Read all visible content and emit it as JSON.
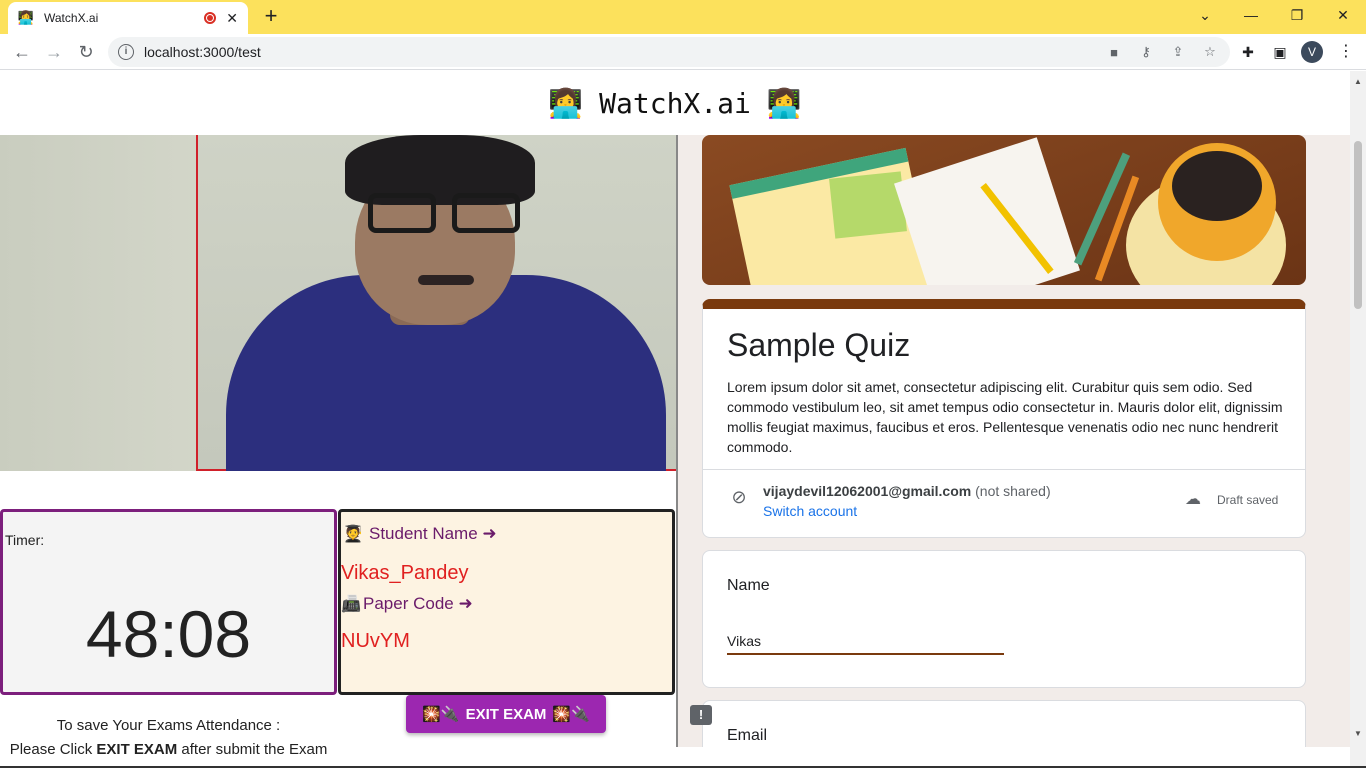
{
  "browser": {
    "tab_title": "WatchX.ai",
    "tab_favicon": "👩‍💻",
    "new_tab_label": "+",
    "url": "localhost:3000/test",
    "avatar_letter": "V",
    "win_controls": {
      "dropdown": "⌄",
      "minimize": "—",
      "restore": "❐",
      "close": "✕"
    }
  },
  "app": {
    "title": "WatchX.ai",
    "emoji": "👩‍💻"
  },
  "timer": {
    "label": "Timer:",
    "value": "48:08"
  },
  "student": {
    "name_label": "Student Name ➜",
    "name_icon": "🧑‍🎓",
    "name_value": "Vikas_Pandey",
    "paper_label": "Paper Code ➜",
    "paper_icon": "📠",
    "paper_value": "NUvYM"
  },
  "exit_button": {
    "label": "EXIT EXAM",
    "left_decor": "🎇🔌",
    "right_decor": "🎇🔌"
  },
  "save_note": {
    "line1": "To save Your Exams Attendance :",
    "line2_prefix": "Please Click ",
    "line2_bold": "EXIT EXAM",
    "line2_suffix": " after submit the Exam"
  },
  "form": {
    "title": "Sample Quiz",
    "description": "Lorem ipsum dolor sit amet, consectetur adipiscing elit. Curabitur quis sem odio. Sed commodo vestibulum leo, sit amet tempus odio consectetur in. Mauris dolor elit, dignissim mollis feugiat maximus, faucibus et eros. Pellentesque venenatis odio nec nunc hendrerit commodo.",
    "account_email": "vijaydevil12062001@gmail.com",
    "not_shared": "(not shared)",
    "switch_account": "Switch account",
    "draft_status": "Draft saved",
    "questions": [
      {
        "label": "Name",
        "answer": "Vikas"
      },
      {
        "label": "Email"
      }
    ],
    "accent_color": "#7a3a0e"
  }
}
